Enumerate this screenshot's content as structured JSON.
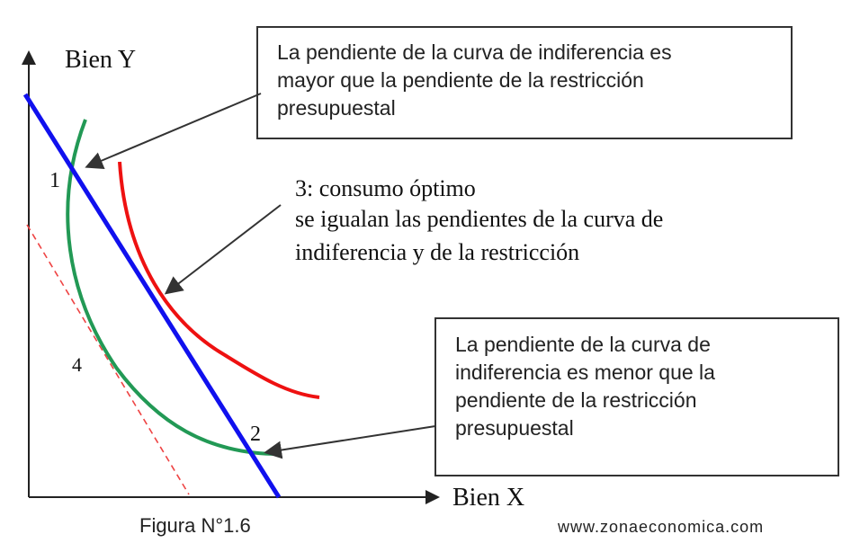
{
  "axes": {
    "y_label": "Bien Y",
    "x_label": "Bien X"
  },
  "points": {
    "p1": "1",
    "p2": "2",
    "p4": "4"
  },
  "box_top": {
    "lines": [
      "La pendiente de la curva de indiferencia es",
      "mayor que la pendiente de la restricción",
      "presupuestal"
    ]
  },
  "note_optimum": {
    "lines": [
      "3: consumo óptimo",
      "se igualan las pendientes de la curva de",
      "indiferencia y de la restricción"
    ]
  },
  "box_bottom": {
    "lines": [
      "La pendiente de la curva de",
      "indiferencia es menor que la",
      "pendiente de la restricción",
      "presupuestal"
    ]
  },
  "caption": "Figura N°1.6",
  "watermark": "www.zonaeconomica.com",
  "colors": {
    "budget_line": "#1010ee",
    "curve_red": "#ee1111",
    "curve_green": "#229955",
    "dashed_line": "#ee4444"
  }
}
